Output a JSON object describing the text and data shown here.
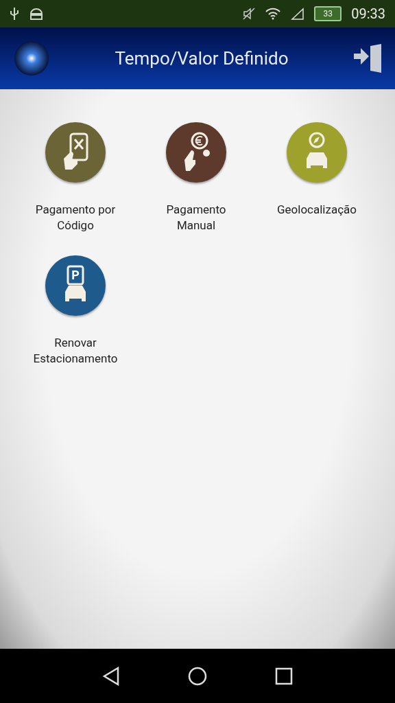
{
  "status_bar": {
    "time": "09:33",
    "battery": "33"
  },
  "header": {
    "title": "Tempo/Valor Definido"
  },
  "menu": [
    {
      "kind": "qr",
      "color": "#6b6437",
      "label": "Pagamento por\nCódigo"
    },
    {
      "kind": "coin",
      "color": "#5e3a2c",
      "label": "Pagamento\nManual"
    },
    {
      "kind": "geo",
      "color": "#9ea22c",
      "label": "Geolocalização"
    },
    {
      "kind": "renew",
      "color": "#1f5a8c",
      "label": "Renovar\nEstacionamento",
      "icon_text": "P"
    }
  ]
}
